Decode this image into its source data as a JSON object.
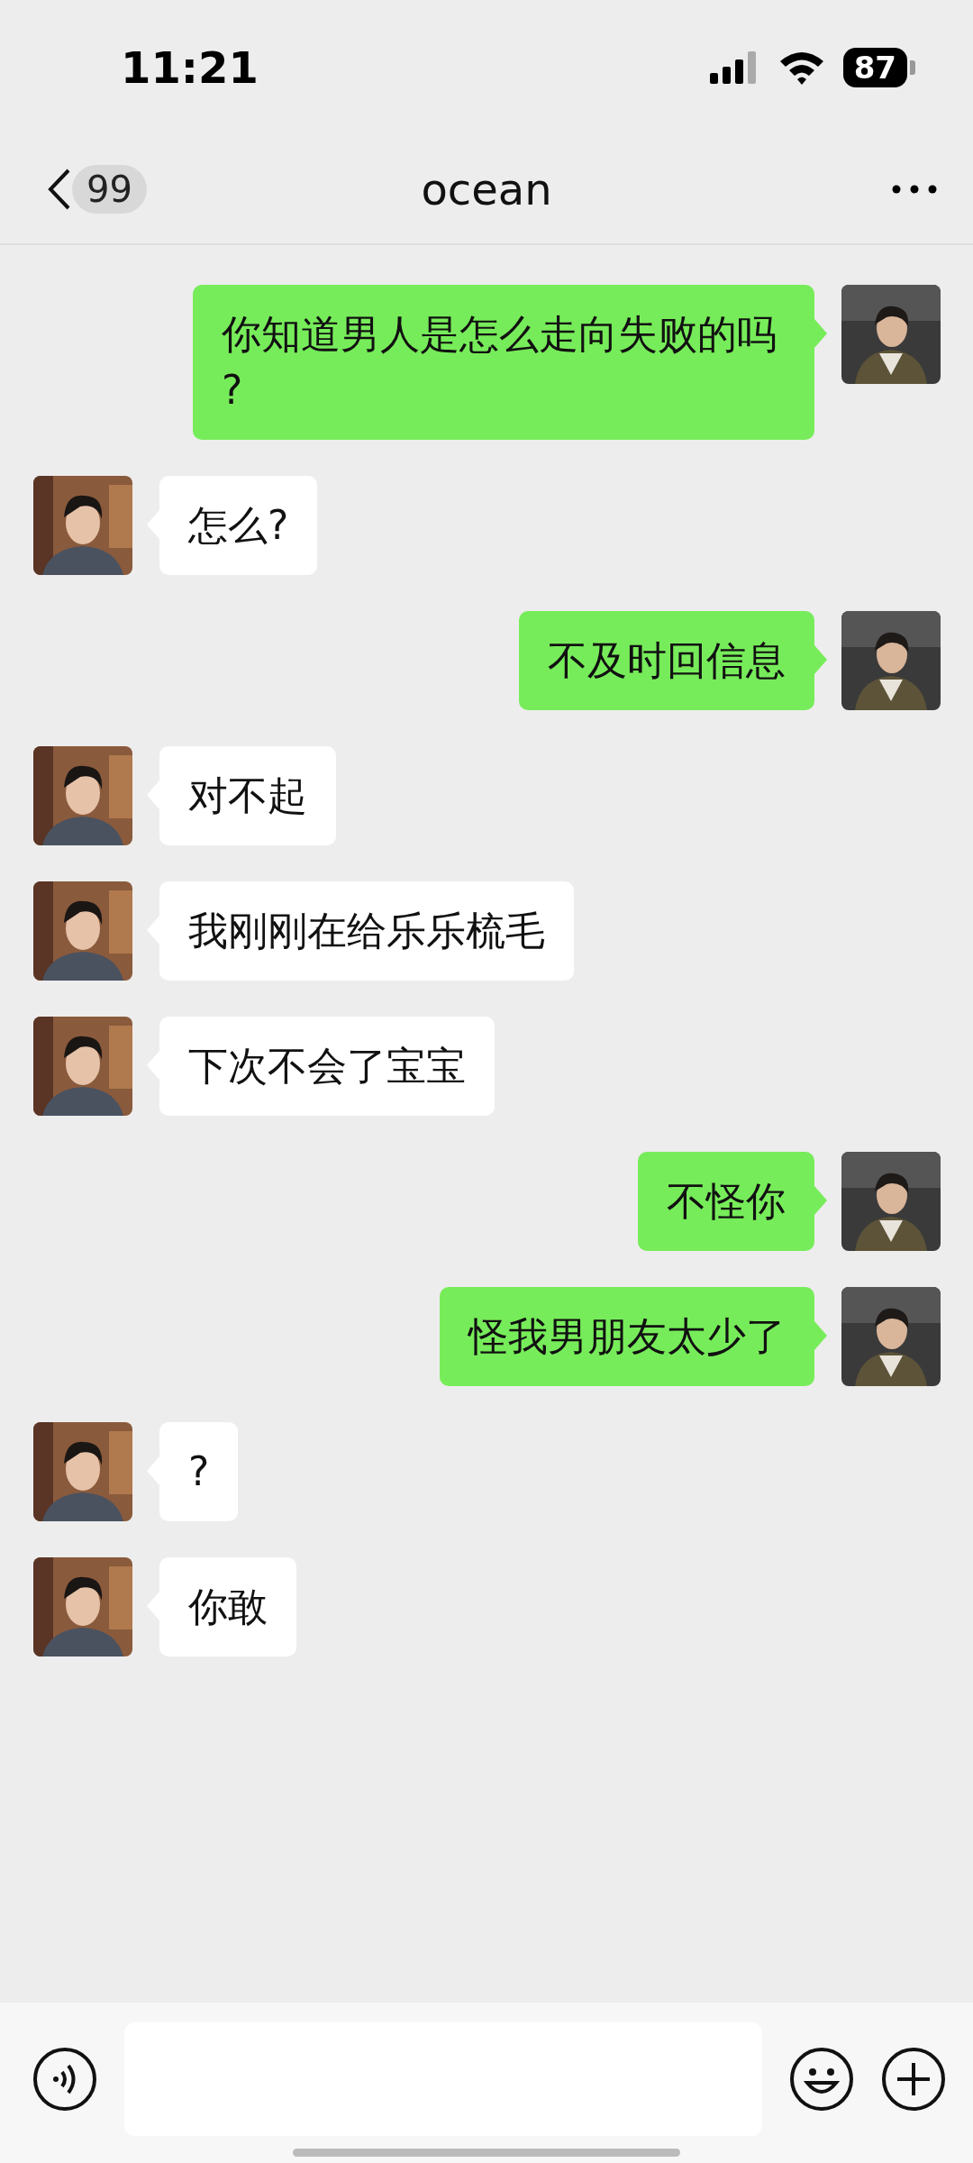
{
  "status_bar": {
    "time": "11:21",
    "battery": "87"
  },
  "header": {
    "back_badge": "99",
    "title": "ocean"
  },
  "messages": [
    {
      "kind": "self",
      "text": "你知道男人是怎么走向失败的吗?"
    },
    {
      "kind": "other",
      "text": "怎么?"
    },
    {
      "kind": "self",
      "text": "不及时回信息"
    },
    {
      "kind": "other",
      "text": "对不起"
    },
    {
      "kind": "other",
      "text": "我刚刚在给乐乐梳毛"
    },
    {
      "kind": "other",
      "text": "下次不会了宝宝"
    },
    {
      "kind": "self",
      "text": "不怪你"
    },
    {
      "kind": "self",
      "text": "怪我男朋友太少了"
    },
    {
      "kind": "other",
      "text": "?"
    },
    {
      "kind": "other",
      "text": "你敢"
    }
  ]
}
